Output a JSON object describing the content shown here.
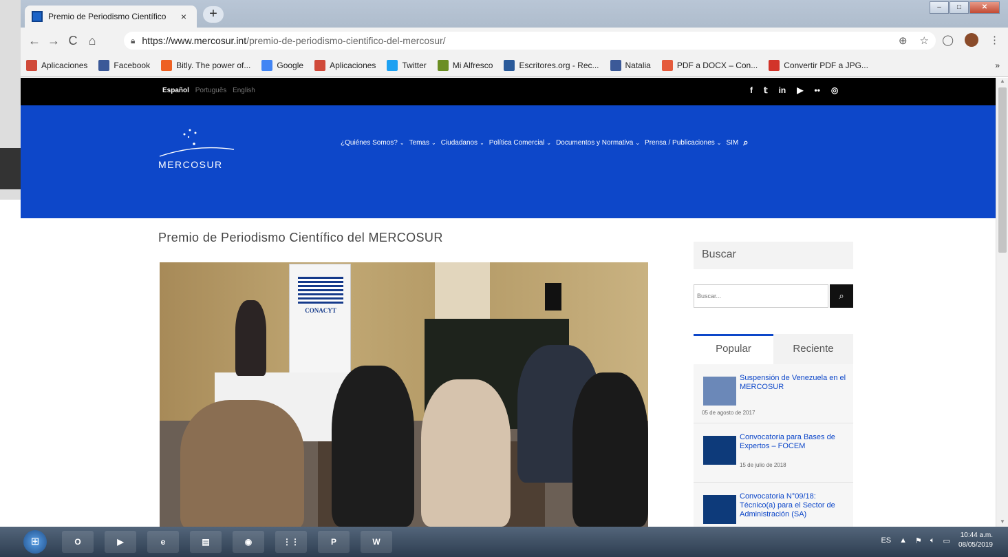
{
  "browser": {
    "tab_title": "Premio de Periodismo Científico",
    "close_glyph": "×",
    "new_tab_glyph": "+",
    "url_host": "https://www.mercosur.int",
    "url_path": "/premio-de-periodismo-cientifico-del-mercosur/",
    "bookmarks": [
      {
        "label": "Aplicaciones",
        "icon": "apps-grid-icon",
        "color": "#d04a3a"
      },
      {
        "label": "Facebook",
        "icon": "facebook-icon",
        "color": "#3b5998"
      },
      {
        "label": "Bitly. The power of...",
        "icon": "bitly-icon",
        "color": "#ee6123"
      },
      {
        "label": "Google",
        "icon": "google-icon",
        "color": "#4285f4"
      },
      {
        "label": "Aplicaciones",
        "icon": "apps-grid-icon",
        "color": "#d04a3a"
      },
      {
        "label": "Twitter",
        "icon": "twitter-icon",
        "color": "#1da1f2"
      },
      {
        "label": "Mi Alfresco",
        "icon": "alfresco-icon",
        "color": "#6b8e23"
      },
      {
        "label": "Escritores.org - Rec...",
        "icon": "escritores-icon",
        "color": "#2a5a9a"
      },
      {
        "label": "Natalia",
        "icon": "facebook-icon",
        "color": "#3b5998"
      },
      {
        "label": "PDF a DOCX – Con...",
        "icon": "pdf-icon",
        "color": "#e55b3c"
      },
      {
        "label": "Convertir PDF a JPG...",
        "icon": "heart-icon",
        "color": "#d2342a"
      }
    ],
    "bookmarks_more": "»"
  },
  "site": {
    "languages": [
      "Español",
      "Português",
      "English"
    ],
    "active_language": "Español",
    "social_icons": [
      "facebook-icon",
      "twitter-icon",
      "linkedin-icon",
      "youtube-icon",
      "flickr-icon",
      "instagram-icon"
    ],
    "social_glyphs": [
      "f",
      "𝕥",
      "in",
      "▶",
      "••",
      "◎"
    ],
    "logo_text": "MERCOSUR",
    "brand_color": "#0d47c9",
    "nav": [
      {
        "label": "¿Quiénes Somos?",
        "caret": true
      },
      {
        "label": "Temas",
        "caret": true
      },
      {
        "label": "Ciudadanos",
        "caret": true
      },
      {
        "label": "Política Comercial",
        "caret": true
      },
      {
        "label": "Documentos y Normativa",
        "caret": true
      },
      {
        "label": "Prensa / Publicaciones",
        "caret": true
      },
      {
        "label": "SIM",
        "caret": false
      }
    ]
  },
  "article": {
    "title": "Premio de Periodismo Científico del MERCOSUR",
    "photo_banner_text": "CONACYT"
  },
  "sidebar": {
    "search_heading": "Buscar",
    "search_placeholder": "Buscar...",
    "tabs": [
      "Popular",
      "Reciente"
    ],
    "active_tab": "Popular",
    "posts": [
      {
        "title": "Suspensión de Venezuela en el MERCOSUR",
        "date": "05 de agosto de 2017"
      },
      {
        "title": "Convocatoria para Bases de Expertos – FOCEM",
        "date": "15 de julio de 2018"
      },
      {
        "title": "Convocatoria N°09/18: Técnico(a) para el Sector de Administración (SA)",
        "date": ""
      }
    ]
  },
  "taskbar": {
    "apps": [
      {
        "name": "outlook",
        "label": "O"
      },
      {
        "name": "media-player",
        "label": "▶"
      },
      {
        "name": "internet-explorer",
        "label": "e"
      },
      {
        "name": "file-explorer",
        "label": "▤"
      },
      {
        "name": "chrome",
        "label": "◉"
      },
      {
        "name": "app-grid",
        "label": "⋮⋮"
      },
      {
        "name": "powerpoint",
        "label": "P"
      },
      {
        "name": "word",
        "label": "W"
      }
    ],
    "lang": "ES",
    "time": "10:44 a.m.",
    "date": "08/05/2019"
  }
}
